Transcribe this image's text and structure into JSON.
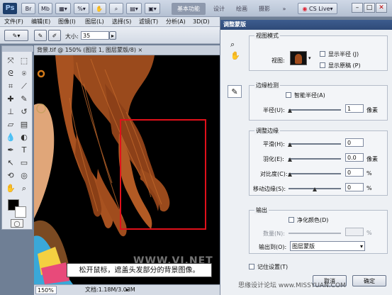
{
  "app": {
    "logo": "Ps",
    "workspaces": [
      "基本功能",
      "设计",
      "绘画",
      "摄影"
    ],
    "active_workspace": "基本功能",
    "cs_live": "CS Live"
  },
  "menu": [
    "文件(F)",
    "编辑(E)",
    "图像(I)",
    "图层(L)",
    "选择(S)",
    "滤镜(T)",
    "分析(A)",
    "3D(D)"
  ],
  "options": {
    "size_label": "大小:",
    "size_value": "35"
  },
  "document": {
    "tab_title": "背景.tif @ 150% (图层 1, 图层蒙版/8) ×",
    "zoom": "150%",
    "doc_info": "文档:1.18M/3.03M"
  },
  "caption": "松开鼠标，遮盖头发部分的背景图像。",
  "watermark": "思缘设计论坛 www.MISSYUAN.COM",
  "watermark2": "WWW.VI.NET",
  "dialog": {
    "title": "调整蒙版",
    "view_mode": {
      "title": "视图模式",
      "view_label": "视图:",
      "show_radius": "显示半径 (J)",
      "show_original": "显示原稿 (P)"
    },
    "edge_detection": {
      "title": "边缘检测",
      "smart_radius": "智能半径(A)",
      "radius_label": "半径(U):",
      "radius_value": "1",
      "radius_unit": "像素",
      "radius_level": 0.01
    },
    "adjust_edge": {
      "title": "调整边缘",
      "rows": [
        {
          "label": "平滑(H):",
          "value": "0",
          "unit": "",
          "level": 0.0
        },
        {
          "label": "羽化(E):",
          "value": "0.0",
          "unit": "像素",
          "level": 0.0
        },
        {
          "label": "对比度(C):",
          "value": "0",
          "unit": "%",
          "level": 0.0
        },
        {
          "label": "移动边缘(S):",
          "value": "0",
          "unit": "%",
          "level": 0.5
        }
      ]
    },
    "output": {
      "title": "输出",
      "decontaminate": "净化颜色(D)",
      "amount_label": "数量(N):",
      "amount_unit": "%",
      "output_to_label": "输出到(O):",
      "output_to_value": "图层蒙版"
    },
    "remember": "记住设置(T)",
    "cancel": "取消",
    "ok": "确定"
  },
  "colors": {
    "accent": "#2e4a78",
    "selection_box": "#e0101a",
    "hair": "#9a4a1c"
  }
}
